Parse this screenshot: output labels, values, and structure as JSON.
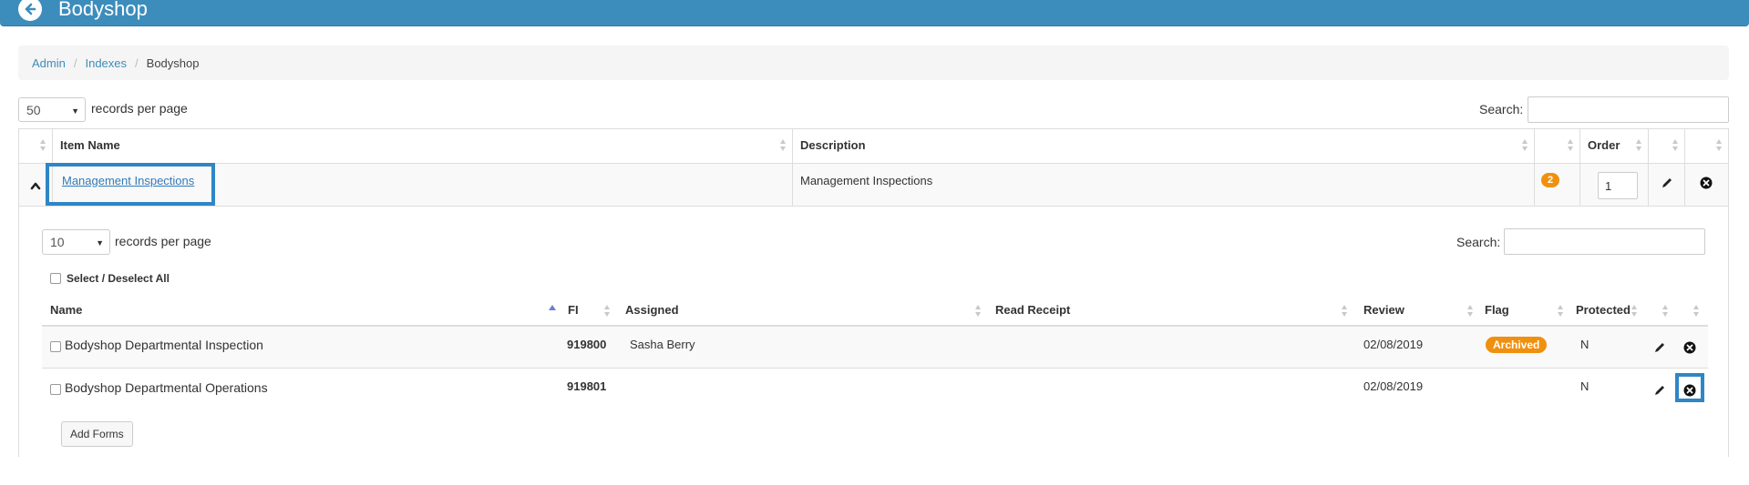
{
  "header": {
    "title": "Bodyshop",
    "back_icon": "arrow-left-circle-icon",
    "color": "#3c8dbc"
  },
  "breadcrumb": {
    "items": [
      "Admin",
      "Indexes",
      "Bodyshop"
    ]
  },
  "outer": {
    "page_size": "50",
    "rpp_label": "records per page",
    "search_label": "Search:",
    "search_value": "",
    "columns": [
      "",
      "Item Name",
      "Description",
      "",
      "Order",
      "",
      ""
    ],
    "row": {
      "item_name": "Management Inspections",
      "description": "Management Inspections",
      "count_badge": "2",
      "order": "1"
    }
  },
  "inner": {
    "page_size": "10",
    "rpp_label": "records per page",
    "search_label": "Search:",
    "search_value": "",
    "select_all_label": "Select / Deselect All",
    "columns": [
      "Name",
      "FI",
      "Assigned",
      "Read Receipt",
      "Review",
      "Flag",
      "Protected"
    ],
    "rows": [
      {
        "name": "Bodyshop Departmental Inspection",
        "fi": "919800",
        "assigned": "Sasha Berry",
        "read_receipt": "",
        "review": "02/08/2019",
        "flag": "Archived",
        "protected": "N"
      },
      {
        "name": "Bodyshop Departmental Operations",
        "fi": "919801",
        "assigned": "",
        "read_receipt": "",
        "review": "02/08/2019",
        "flag": "",
        "protected": "N"
      }
    ],
    "add_forms_label": "Add Forms"
  },
  "colors": {
    "accent": "#3c8dbc",
    "badge": "#f0900f",
    "highlight": "#2f86c6"
  }
}
